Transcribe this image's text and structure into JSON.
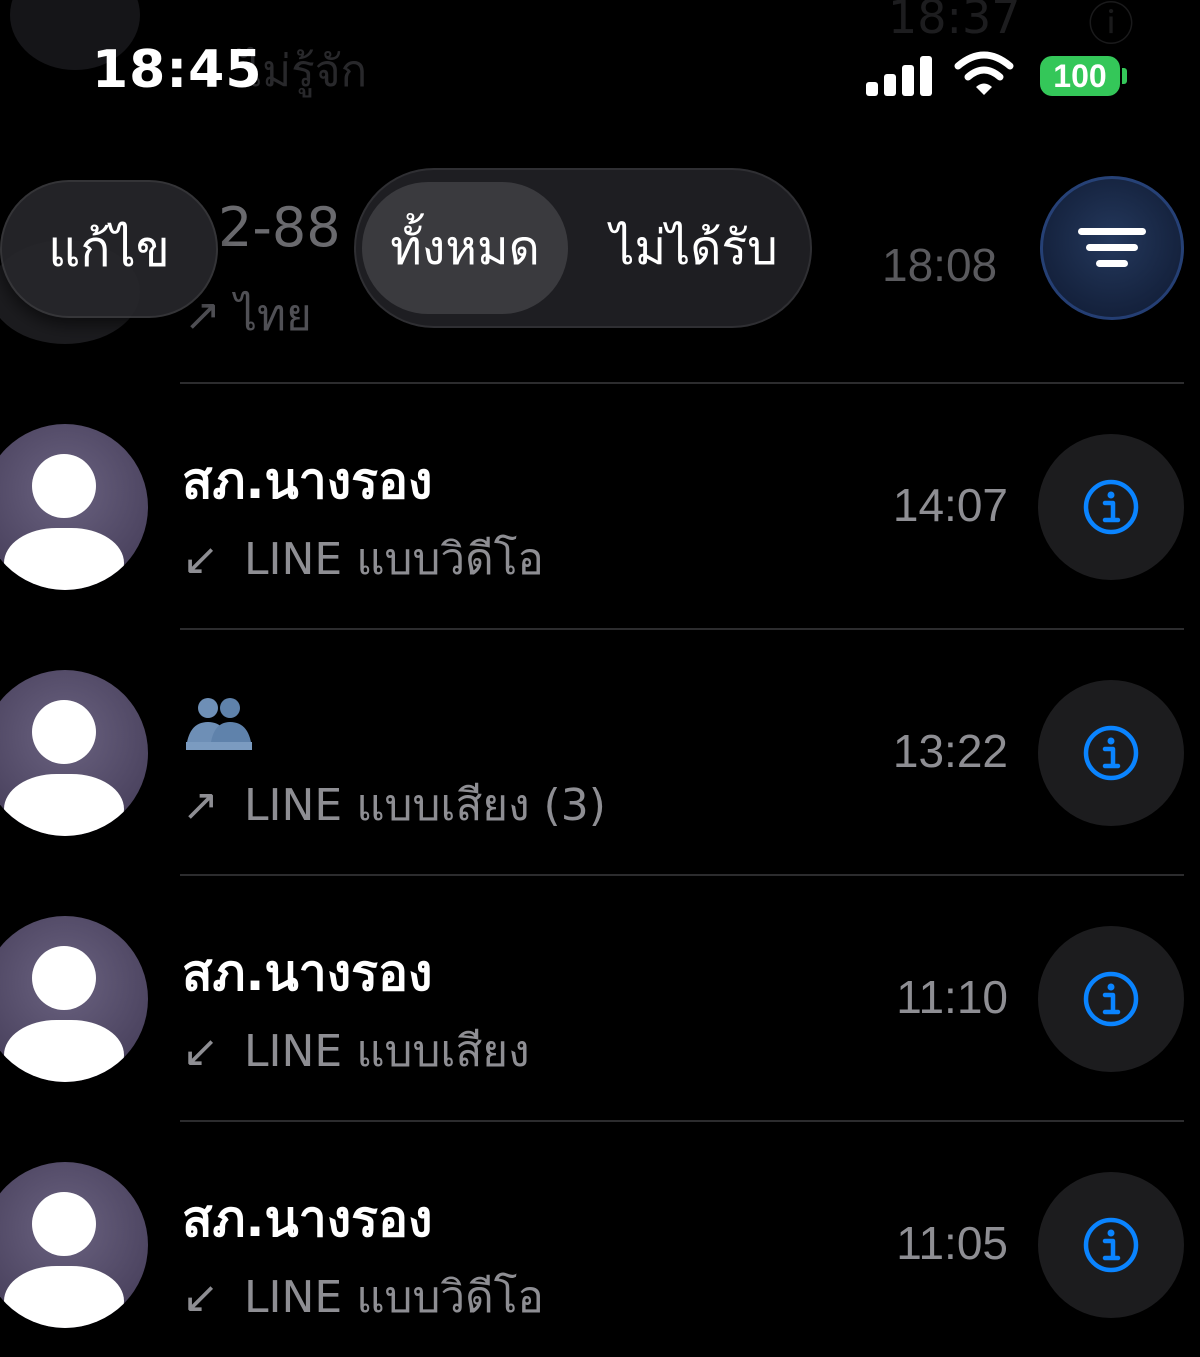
{
  "status_bar": {
    "time": "18:45",
    "battery": "100"
  },
  "background_rows": [
    {
      "name": "ไม่รู้จัก",
      "time": "18:37"
    },
    {
      "name": "2-88",
      "detail": "↗ ไทย"
    }
  ],
  "toolbar": {
    "edit_label": "แก้ไข",
    "segments": [
      "ทั้งหมด",
      "ไม่ได้รับ"
    ],
    "selected_segment": "ทั้งหมด",
    "filter_icon": "filter-lines-icon"
  },
  "first_row_time": "18:08",
  "calls": [
    {
      "name": "สภ.นางรอง",
      "direction": "↙",
      "type": "LINE แบบวิดีโอ",
      "time": "14:07"
    },
    {
      "name": "",
      "name_icon": "busts-in-silhouette-emoji",
      "direction": "↗",
      "type": "LINE แบบเสียง (3)",
      "time": "13:22"
    },
    {
      "name": "สภ.นางรอง",
      "direction": "↙",
      "type": "LINE แบบเสียง",
      "time": "11:10"
    },
    {
      "name": "สภ.นางรอง",
      "direction": "↙",
      "type": "LINE แบบวิดีโอ",
      "time": "11:05"
    }
  ],
  "colors": {
    "background": "#000000",
    "accent_blue": "#0a84ff",
    "secondary_text": "#8e8e93",
    "battery_green": "#34c759",
    "avatar": "#4c4460"
  }
}
